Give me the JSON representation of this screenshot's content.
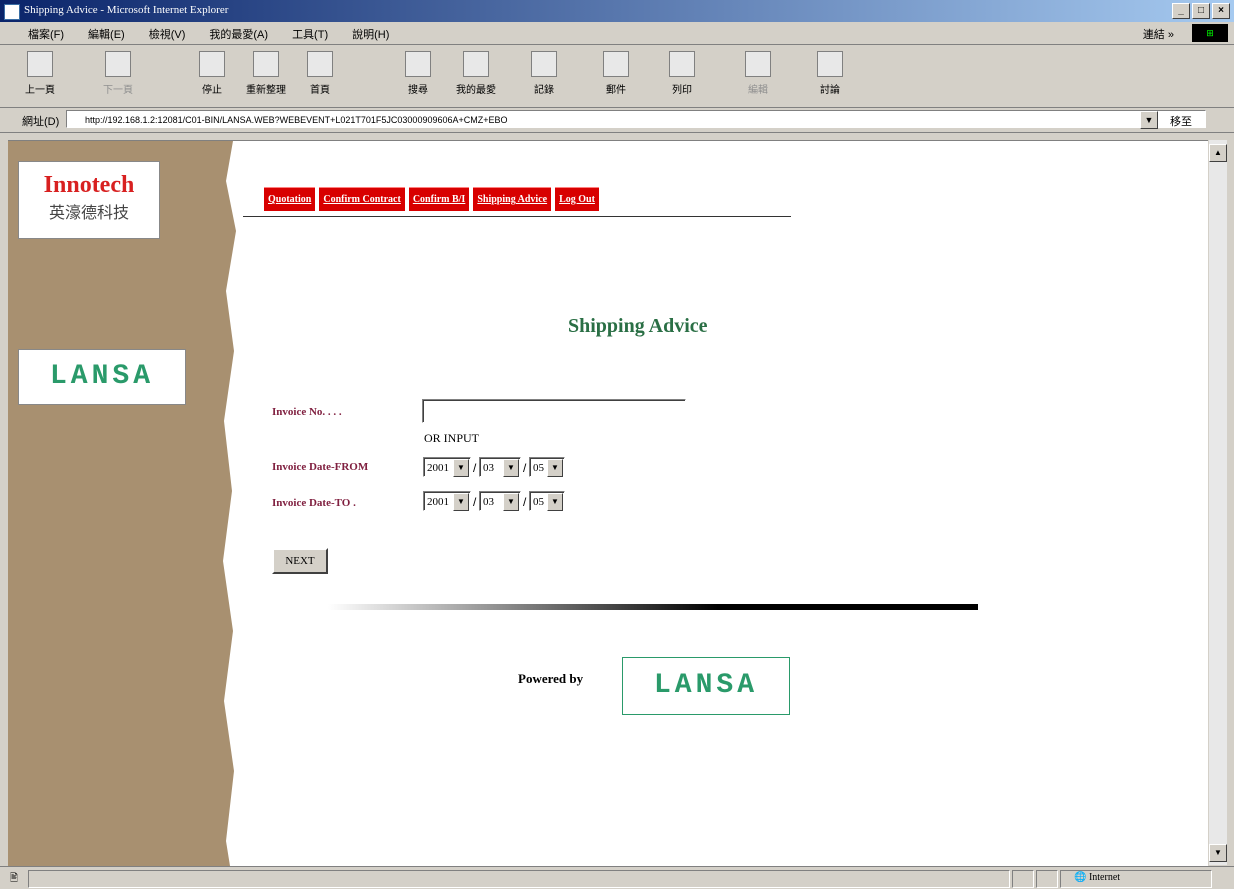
{
  "window": {
    "title": "Shipping Advice - Microsoft Internet Explorer",
    "buttons": [
      "_",
      "□",
      "×"
    ]
  },
  "menu": {
    "items": [
      "檔案(F)",
      "編輯(E)",
      "檢視(V)",
      "我的最愛(A)",
      "工具(T)",
      "說明(H)"
    ],
    "links_label": "連結 »"
  },
  "toolbar": {
    "items": [
      {
        "label": "上一頁",
        "icon": "back-arrow-icon",
        "enabled": true
      },
      {
        "label": "下一頁",
        "icon": "forward-arrow-icon",
        "enabled": false
      },
      {
        "label": "停止",
        "icon": "stop-icon",
        "enabled": true
      },
      {
        "label": "重新整理",
        "icon": "refresh-icon",
        "enabled": true
      },
      {
        "label": "首頁",
        "icon": "home-icon",
        "enabled": true
      },
      {
        "label": "搜尋",
        "icon": "search-icon",
        "enabled": true
      },
      {
        "label": "我的最愛",
        "icon": "favorites-icon",
        "enabled": true
      },
      {
        "label": "記錄",
        "icon": "history-icon",
        "enabled": true
      },
      {
        "label": "郵件",
        "icon": "mail-icon",
        "enabled": true
      },
      {
        "label": "列印",
        "icon": "print-icon",
        "enabled": true
      },
      {
        "label": "編輯",
        "icon": "edit-icon",
        "enabled": false
      },
      {
        "label": "討論",
        "icon": "discuss-icon",
        "enabled": true
      }
    ]
  },
  "address": {
    "label": "網址(D)",
    "url": "http://192.168.1.2:12081/C01-BIN/LANSA.WEB?WEBEVENT+L021T701F5JC03000909606A+CMZ+EBO",
    "go_label": "移至"
  },
  "page": {
    "nav_tabs": [
      "Quotation",
      "Confirm Contract",
      "Confirm B/I",
      "Shipping Advice",
      "Log Out"
    ],
    "heading": "Shipping Advice",
    "logo_company_en": "Innotech",
    "logo_company_zh": "英濠德科技",
    "logo_product": "LANSA",
    "form": {
      "invoice_no_label": "Invoice No. . . .",
      "invoice_no_value": "",
      "or_input": "OR INPUT",
      "date_from_label": "Invoice Date-FROM",
      "date_to_label": "Invoice Date-TO .",
      "from_year": "2001",
      "from_month": "03",
      "from_day": "05",
      "to_year": "2001",
      "to_month": "03",
      "to_day": "05",
      "date_separator": "/",
      "next_button": "NEXT"
    },
    "powered_by": "Powered by",
    "powered_logo": "LANSA"
  },
  "status": {
    "zone": "Internet"
  }
}
